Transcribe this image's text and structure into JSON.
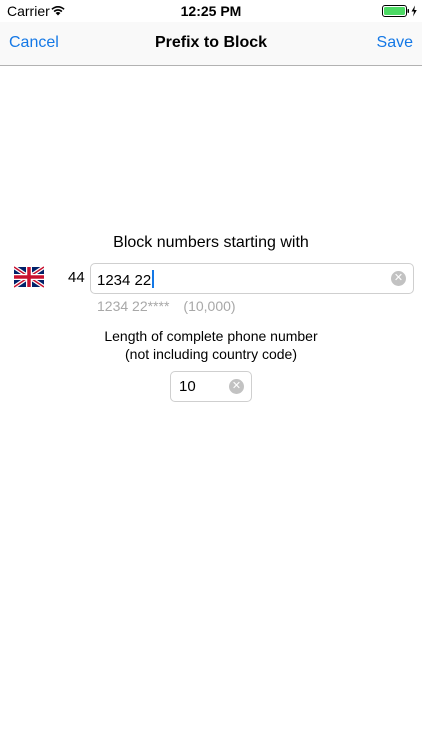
{
  "status_bar": {
    "carrier": "Carrier",
    "time": "12:25 PM"
  },
  "nav": {
    "cancel_label": "Cancel",
    "title": "Prefix to Block",
    "save_label": "Save"
  },
  "form": {
    "block_label": "Block numbers starting with",
    "country_code": "44",
    "prefix_value": "1234 22",
    "pattern_preview": "1234 22****",
    "pattern_count": "(10,000)",
    "length_label_line1": "Length of complete phone number",
    "length_label_line2": "(not including country code)",
    "length_value": "10"
  },
  "colors": {
    "accent": "#1478e6",
    "hint_text": "#a8a8a8",
    "battery": "#4cd964"
  }
}
